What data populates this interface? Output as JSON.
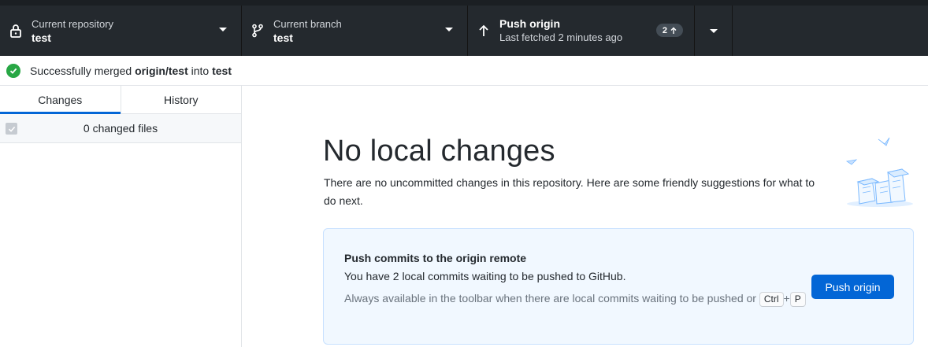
{
  "toolbar": {
    "repository": {
      "label": "Current repository",
      "value": "test",
      "icon": "lock-icon"
    },
    "branch": {
      "label": "Current branch",
      "value": "test",
      "icon": "branch-icon"
    },
    "push": {
      "label": "Push origin",
      "value": "Last fetched 2 minutes ago",
      "ahead_count": "2",
      "icon": "arrow-up-icon"
    }
  },
  "banner": {
    "prefix": "Successfully merged",
    "source": "origin/test",
    "middle": "into",
    "target": "test"
  },
  "sidebar": {
    "tabs": [
      {
        "label": "Changes",
        "active": true
      },
      {
        "label": "History",
        "active": false
      }
    ],
    "changed_files": "0 changed files"
  },
  "main": {
    "title": "No local changes",
    "description": "There are no uncommitted changes in this repository. Here are some friendly suggestions for what to do next.",
    "push_card": {
      "title": "Push commits to the origin remote",
      "body": "You have 2 local commits waiting to be pushed to GitHub.",
      "hint_prefix": "Always available in the toolbar when there are local commits waiting to be pushed or",
      "shortcut_key1": "Ctrl",
      "shortcut_plus": "+",
      "shortcut_key2": "P",
      "button_label": "Push origin"
    }
  },
  "colors": {
    "toolbar_bg": "#24292e",
    "accent": "#0366d6",
    "success": "#28a745",
    "card_bg": "#f1f8ff"
  }
}
